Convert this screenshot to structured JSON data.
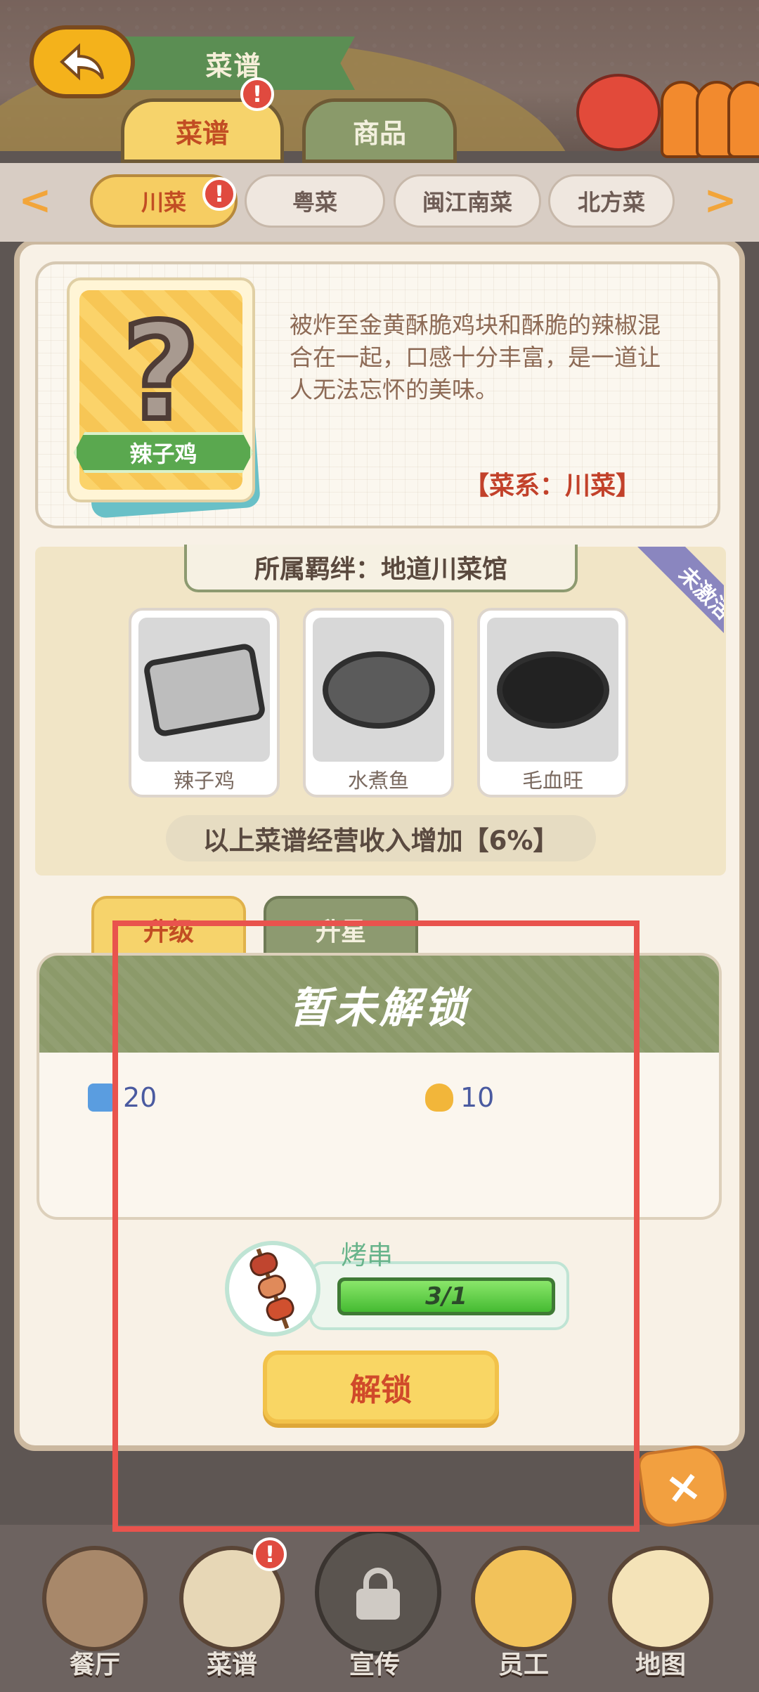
{
  "header": {
    "title": "菜谱",
    "tabs": [
      {
        "label": "菜谱",
        "badge": "!"
      },
      {
        "label": "商品"
      }
    ]
  },
  "categories": {
    "prev": "<",
    "next": ">",
    "items": [
      {
        "label": "川菜",
        "active": true,
        "badge": "!"
      },
      {
        "label": "粤菜"
      },
      {
        "label": "闽江南菜"
      },
      {
        "label": "北方菜"
      }
    ]
  },
  "recipe": {
    "icon": "question-mark-icon",
    "name": "辣子鸡",
    "description": "被炸至金黄酥脆鸡块和酥脆的辣椒混合在一起，口感十分丰富，是一道让人无法忘怀的美味。",
    "cuisine": "【菜系：川菜】"
  },
  "bond": {
    "title": "所属羁绊：地道川菜馆",
    "status": "未激活",
    "dishes": [
      {
        "name": "辣子鸡"
      },
      {
        "name": "水煮鱼"
      },
      {
        "name": "毛血旺"
      }
    ],
    "bonus": "以上菜谱经营收入增加【6%】"
  },
  "subtabs": {
    "upgrade": "升级",
    "star": "升星"
  },
  "lock": {
    "title": "暂未解锁",
    "costs": [
      {
        "icon": "fish-icon",
        "value": "20"
      },
      {
        "icon": "money-bag-icon",
        "value": "10"
      }
    ],
    "material": {
      "name": "烤串",
      "progress_text": "3/1",
      "progress": 1.0
    },
    "unlock_label": "解锁",
    "close_label": "×"
  },
  "nav": {
    "items": [
      {
        "label": "餐厅"
      },
      {
        "label": "菜谱",
        "badge": "!"
      },
      {
        "label": "宣传"
      },
      {
        "label": "员工"
      },
      {
        "label": "地图"
      }
    ]
  },
  "colors": {
    "accent": "#f6d36b",
    "olive": "#8c9a6a",
    "highlight": "#e9534d",
    "alert": "#e04a3f"
  }
}
